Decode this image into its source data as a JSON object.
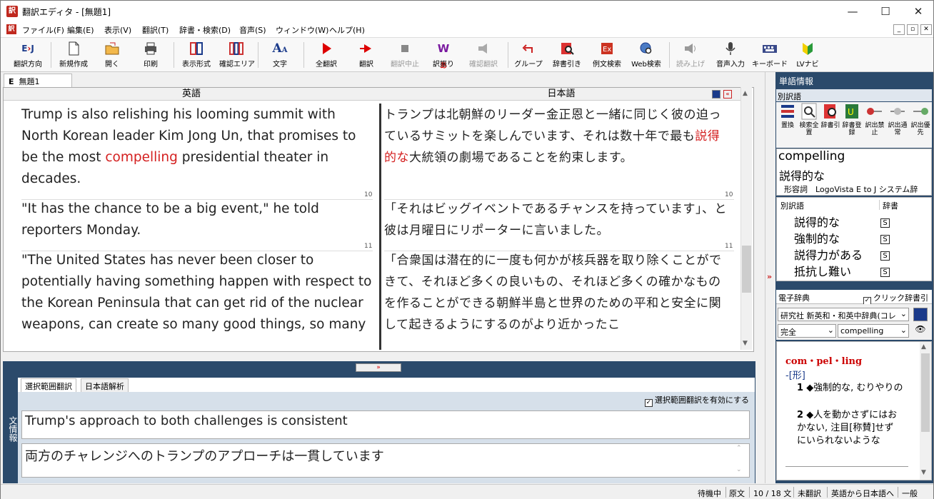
{
  "window": {
    "title": "翻訳エディタ - [無題1]",
    "minimize": "—",
    "maximize": "☐",
    "close": "✕"
  },
  "menu": [
    "ファイル(F)",
    "編集(E)",
    "表示(V)",
    "翻訳(T)",
    "辞書・検索(D)",
    "音声(S)",
    "ウィンドウ(W)",
    "ヘルプ(H)"
  ],
  "toolbar": {
    "direction": "翻訳方向",
    "new": "新規作成",
    "open": "開く",
    "print": "印刷",
    "layout": "表示形式",
    "confirm_area": "確認エリア",
    "font": "文字",
    "translate_all": "全翻訳",
    "translate": "翻訳",
    "stop": "翻訳中止",
    "furigana": "訳振り",
    "confirm_translate": "確認翻訳",
    "group": "グループ",
    "dict_lookup": "辞書引き",
    "example_search": "例文検索",
    "web_search": "Web検索",
    "read_aloud": "読み上げ",
    "voice_input": "音声入力",
    "keyboard": "キーボード",
    "lv_navi": "LVナビ"
  },
  "doc": {
    "tab_prefix": "E",
    "tab_label": "無題1",
    "source_header": "英語",
    "target_header": "日本語",
    "seg1_en_pre": "Trump is also relishing his looming summit with North Korean leader Kim Jong Un, that promises to be the most ",
    "seg1_en_hl": "compelling",
    "seg1_en_post": " presidential theater in decades.",
    "seg1_ja_pre": "トランプは北朝鮮のリーダー金正恩と一緒に同じく彼の迫っているサミットを楽しんでいます、それは数十年で最も",
    "seg1_ja_hl": "説得的な",
    "seg1_ja_post": "大統領の劇場であることを約束します。",
    "num10": "10",
    "seg2_en": "\"It has the chance to be a big event,\" he told reporters Monday.",
    "seg2_ja": "「それはビッグイベントであるチャンスを持っています」、と彼は月曜日にリポーターに言いました。",
    "num11": "11",
    "seg3_en": "\"The United States has never been closer to potentially having something happen with respect to the Korean Peninsula that can get rid of the nuclear weapons, can create so many good things, so many",
    "seg3_ja": "「合衆国は潜在的に一度も何かが核兵器を取り除くことができて、それほど多くの良いもの、それほど多くの確かなものを作ることができる朝鮮半島と世界のための平和と安全に関して起きるようにするのがより近かったこ"
  },
  "bottom": {
    "side_label": "文情報",
    "tab_range": "選択範囲翻訳",
    "tab_jp_analysis": "日本語解析",
    "enable_label": "選択範囲翻訳を有効にする",
    "source_text": "Trump's approach to both challenges is consistent",
    "target_text": "両方のチャレンジへのトランプのアプローチは一貫しています"
  },
  "right": {
    "title": "単語情報",
    "alt_label": "別訳語",
    "icons": [
      "置換",
      "検索全置",
      "辞書引",
      "辞書登録",
      "訳出禁止",
      "訳出通常",
      "訳出優先"
    ],
    "word": "compelling",
    "translation": "説得的な",
    "pos": "形容詞",
    "dict_name": "LogoVista E to J システム辞",
    "col_alt": "別訳語",
    "col_dict": "辞書",
    "alternatives": [
      "説得的な",
      "強制的な",
      "説得力がある",
      "抵抗し難い"
    ],
    "badge": "S",
    "edict_title": "電子辞典",
    "click_dict": "クリック辞書引",
    "dict_select": "研究社 新英和・和英中辞典(コレ",
    "match_select": "完全",
    "search_value": "compelling",
    "entry_head": "com・pel・ling",
    "entry_pos": "-[形]",
    "entry_1_num": "1",
    "entry_1_text": "◆強制的な, むりやりの",
    "entry_2_num": "2",
    "entry_2_text": "◆人を動かさずにはおかない, 注目[称賛]せずにいられないような"
  },
  "status": {
    "state": "待機中",
    "mode": "原文",
    "position": "10 / 18 文",
    "untranslated": "未翻訳",
    "direction": "英語から日本語へ",
    "field": "一般"
  },
  "colors": {
    "accent_red": "#d42020",
    "panel_navy": "#2b4a6b"
  }
}
